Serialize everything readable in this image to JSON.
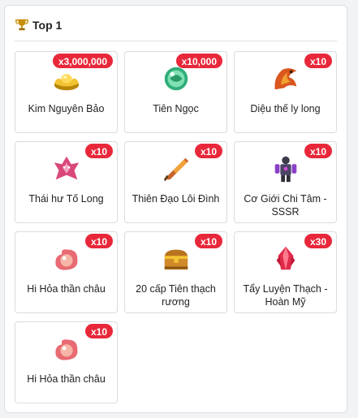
{
  "header": {
    "title": "Top 1",
    "icon": "trophy-icon"
  },
  "colors": {
    "badge": "#e8283a",
    "trophy": "#c8900a"
  },
  "items": [
    {
      "name": "Kim Nguyên Bảo",
      "qty": "x3,000,000",
      "icon": "gold-ingot-icon"
    },
    {
      "name": "Tiên Ngọc",
      "qty": "x10,000",
      "icon": "jade-orb-icon"
    },
    {
      "name": "Diệu thế ly long",
      "qty": "x10",
      "icon": "fire-dragon-icon"
    },
    {
      "name": "Thái hư Tố Long",
      "qty": "x10",
      "icon": "pink-dragon-icon"
    },
    {
      "name": "Thiên Đạo Lôi Đình",
      "qty": "x10",
      "icon": "flame-blade-icon"
    },
    {
      "name": "Cơ Giới Chi Tâm - SSSR",
      "qty": "x10",
      "icon": "mech-warrior-icon"
    },
    {
      "name": "Hi Hỏa thần châu",
      "qty": "x10",
      "icon": "fire-pearl-icon"
    },
    {
      "name": "20 cấp Tiên thạch rương",
      "qty": "x10",
      "icon": "treasure-chest-icon"
    },
    {
      "name": "Tẩy Luyện Thạch - Hoàn Mỹ",
      "qty": "x30",
      "icon": "red-crystal-icon"
    },
    {
      "name": "Hi Hỏa thần châu",
      "qty": "x10",
      "icon": "fire-pearl-icon"
    }
  ]
}
